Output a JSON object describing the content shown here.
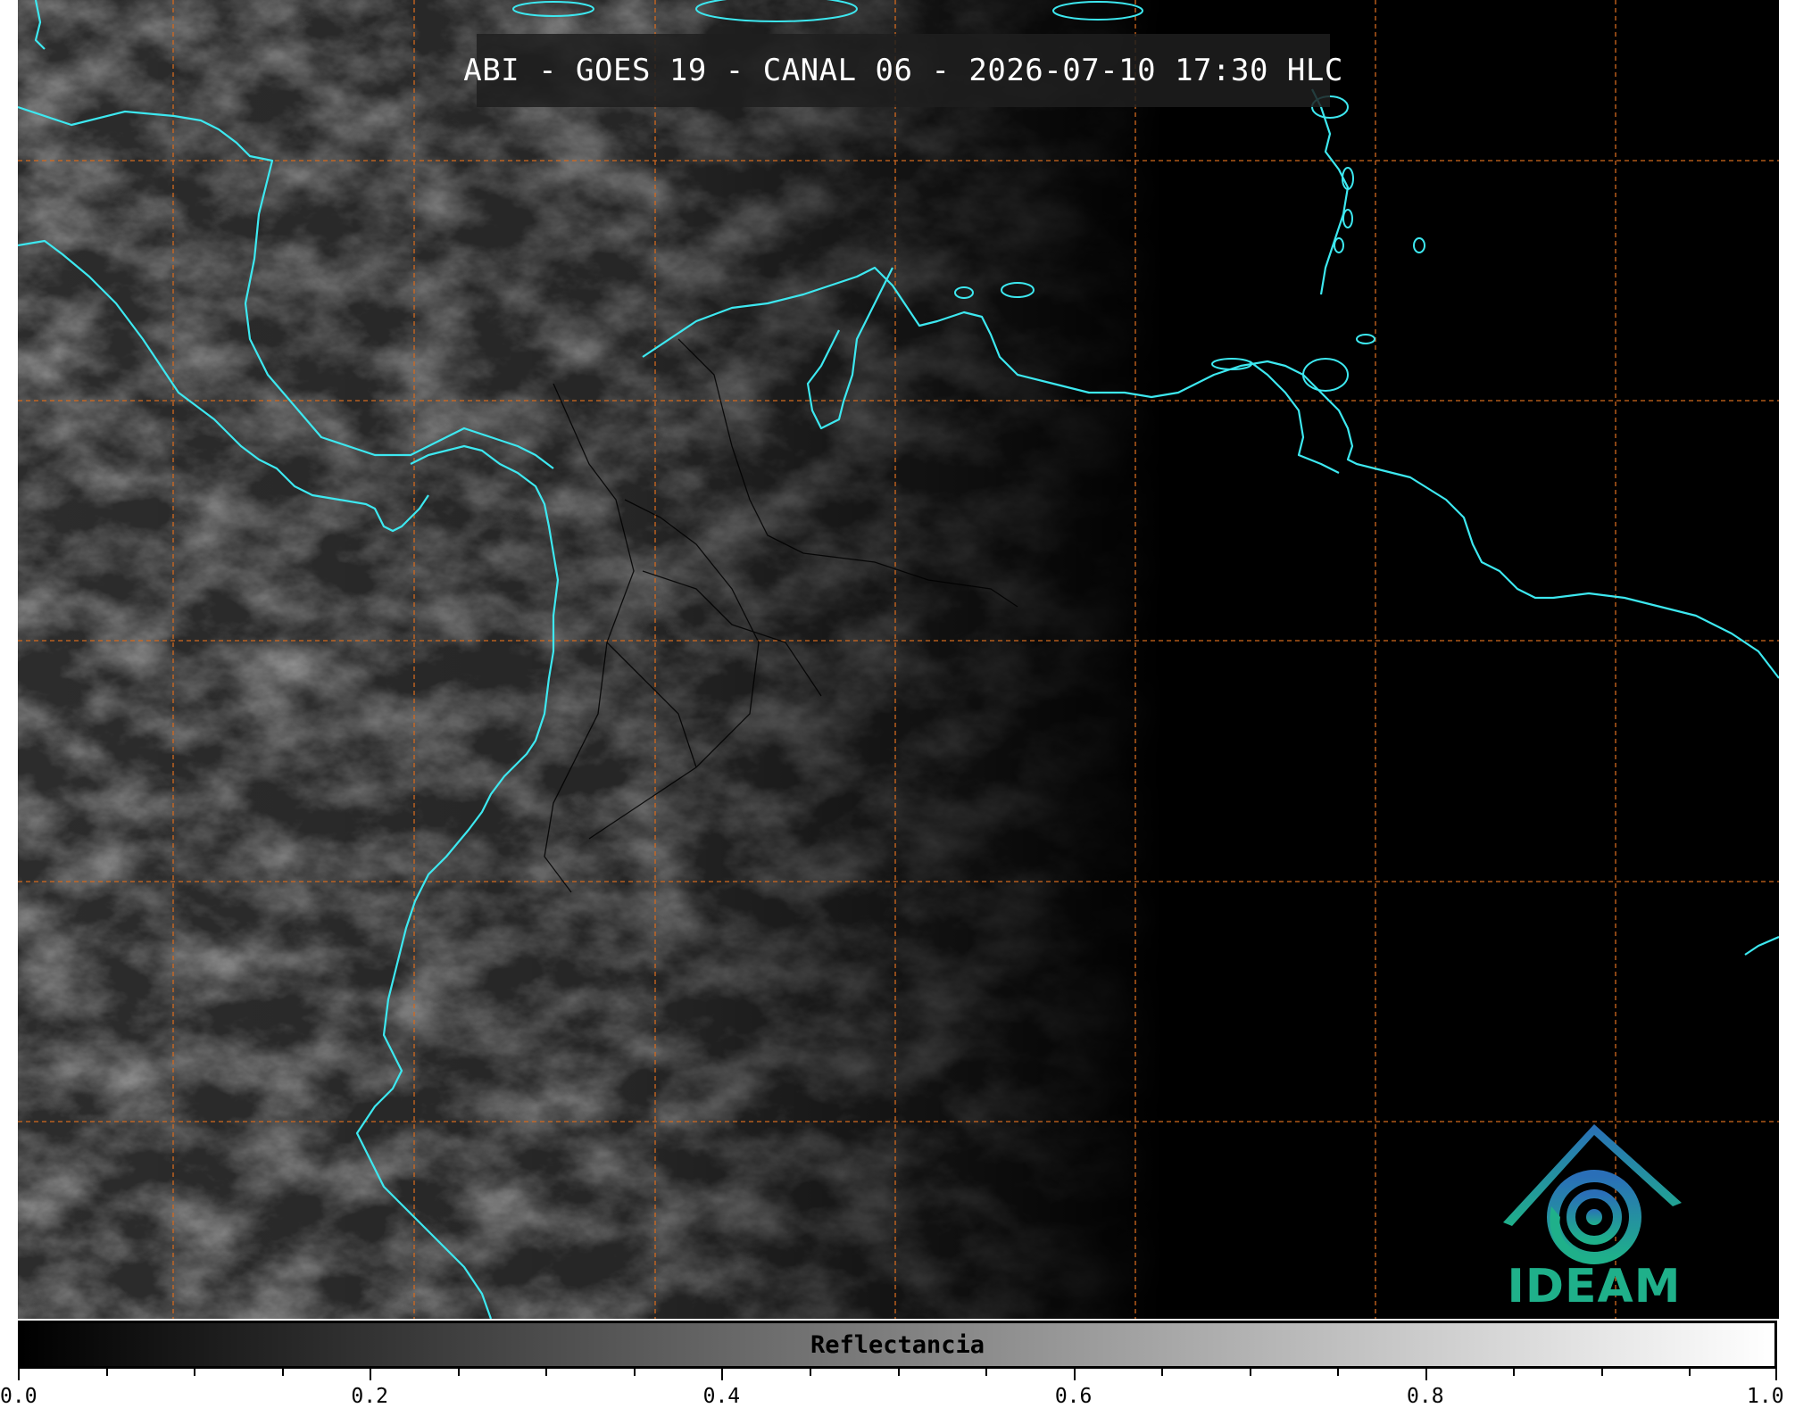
{
  "title": "ABI - GOES 19 - CANAL 06 - 2026-07-10 17:30 HLC",
  "logo": {
    "name": "IDEAM",
    "icon": "ideam-logo-icon",
    "colors": [
      "#2a6fb8",
      "#1fb08a"
    ]
  },
  "colorbar": {
    "label": "Reflectancia",
    "min": 0.0,
    "max": 1.0,
    "tick_labels": [
      "0.0",
      "0.2",
      "0.4",
      "0.6",
      "0.8",
      "1.0"
    ],
    "minor_step": 0.05,
    "colormap": "gray"
  },
  "map": {
    "coastline_color": "#3de8f0",
    "gridline_color": "#d2691e",
    "border_color": "#000000"
  }
}
